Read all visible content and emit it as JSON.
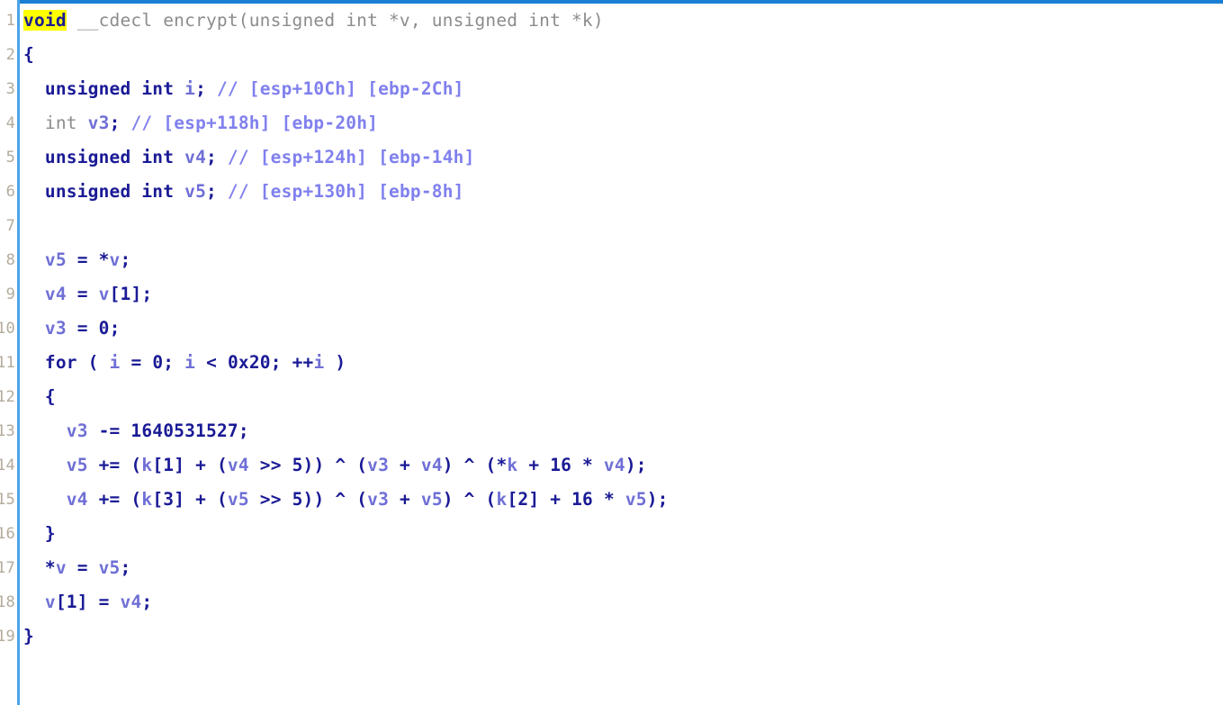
{
  "view": {
    "name": "hexrays-pseudocode",
    "accent_color": "#1a7fd4",
    "gutter_separator_color": "#4aa3e8",
    "background_color": "#ffffff",
    "highlight_color": "#ffff00",
    "keyword_color": "#1a1a96",
    "variable_color": "#6f6fd6",
    "comment_color": "#8080ee",
    "signature_color": "#8c8c8c",
    "lineno_color": "#b4ab9c"
  },
  "code": {
    "lines": [
      {
        "number": "1",
        "tokens": [
          {
            "t": "void",
            "c": "hl"
          },
          {
            "t": " __cdecl encrypt(unsigned int *v, unsigned int *k)",
            "c": "sig"
          }
        ]
      },
      {
        "number": "2",
        "tokens": [
          {
            "t": "{",
            "c": "kw"
          }
        ]
      },
      {
        "number": "3",
        "tokens": [
          {
            "t": "  ",
            "c": "kw"
          },
          {
            "t": "unsigned int",
            "c": "kw"
          },
          {
            "t": " ",
            "c": "kw"
          },
          {
            "t": "i",
            "c": "var"
          },
          {
            "t": "; ",
            "c": "kw"
          },
          {
            "t": "// [esp+10Ch] [ebp-2Ch]",
            "c": "comment"
          }
        ]
      },
      {
        "number": "4",
        "tokens": [
          {
            "t": "  ",
            "c": "kw"
          },
          {
            "t": "int",
            "c": "sig"
          },
          {
            "t": " ",
            "c": "kw"
          },
          {
            "t": "v3",
            "c": "var"
          },
          {
            "t": "; ",
            "c": "kw"
          },
          {
            "t": "// [esp+118h] [ebp-20h]",
            "c": "comment"
          }
        ]
      },
      {
        "number": "5",
        "tokens": [
          {
            "t": "  ",
            "c": "kw"
          },
          {
            "t": "unsigned int",
            "c": "kw"
          },
          {
            "t": " ",
            "c": "kw"
          },
          {
            "t": "v4",
            "c": "var"
          },
          {
            "t": "; ",
            "c": "kw"
          },
          {
            "t": "// [esp+124h] [ebp-14h]",
            "c": "comment"
          }
        ]
      },
      {
        "number": "6",
        "tokens": [
          {
            "t": "  ",
            "c": "kw"
          },
          {
            "t": "unsigned int",
            "c": "kw"
          },
          {
            "t": " ",
            "c": "kw"
          },
          {
            "t": "v5",
            "c": "var"
          },
          {
            "t": "; ",
            "c": "kw"
          },
          {
            "t": "// [esp+130h] [ebp-8h]",
            "c": "comment"
          }
        ]
      },
      {
        "number": "7",
        "tokens": [
          {
            "t": "",
            "c": "kw"
          }
        ]
      },
      {
        "number": "8",
        "tokens": [
          {
            "t": "  ",
            "c": "kw"
          },
          {
            "t": "v5",
            "c": "var"
          },
          {
            "t": " = *",
            "c": "kw"
          },
          {
            "t": "v",
            "c": "var"
          },
          {
            "t": ";",
            "c": "kw"
          }
        ]
      },
      {
        "number": "9",
        "tokens": [
          {
            "t": "  ",
            "c": "kw"
          },
          {
            "t": "v4",
            "c": "var"
          },
          {
            "t": " = ",
            "c": "kw"
          },
          {
            "t": "v",
            "c": "var"
          },
          {
            "t": "[",
            "c": "kw"
          },
          {
            "t": "1",
            "c": "num"
          },
          {
            "t": "];",
            "c": "kw"
          }
        ]
      },
      {
        "number": "10",
        "tokens": [
          {
            "t": "  ",
            "c": "kw"
          },
          {
            "t": "v3",
            "c": "var"
          },
          {
            "t": " = ",
            "c": "kw"
          },
          {
            "t": "0",
            "c": "num"
          },
          {
            "t": ";",
            "c": "kw"
          }
        ]
      },
      {
        "number": "11",
        "tokens": [
          {
            "t": "  ",
            "c": "kw"
          },
          {
            "t": "for",
            "c": "kw"
          },
          {
            "t": " ( ",
            "c": "kw"
          },
          {
            "t": "i",
            "c": "var"
          },
          {
            "t": " = ",
            "c": "kw"
          },
          {
            "t": "0",
            "c": "num"
          },
          {
            "t": "; ",
            "c": "kw"
          },
          {
            "t": "i",
            "c": "var"
          },
          {
            "t": " < ",
            "c": "kw"
          },
          {
            "t": "0x20",
            "c": "num"
          },
          {
            "t": "; ++",
            "c": "kw"
          },
          {
            "t": "i",
            "c": "var"
          },
          {
            "t": " )",
            "c": "kw"
          }
        ]
      },
      {
        "number": "12",
        "tokens": [
          {
            "t": "  {",
            "c": "kw"
          }
        ]
      },
      {
        "number": "13",
        "tokens": [
          {
            "t": "    ",
            "c": "kw"
          },
          {
            "t": "v3",
            "c": "var"
          },
          {
            "t": " -= ",
            "c": "kw"
          },
          {
            "t": "1640531527",
            "c": "num"
          },
          {
            "t": ";",
            "c": "kw"
          }
        ]
      },
      {
        "number": "14",
        "tokens": [
          {
            "t": "    ",
            "c": "kw"
          },
          {
            "t": "v5",
            "c": "var"
          },
          {
            "t": " += (",
            "c": "kw"
          },
          {
            "t": "k",
            "c": "var"
          },
          {
            "t": "[",
            "c": "kw"
          },
          {
            "t": "1",
            "c": "num"
          },
          {
            "t": "] + (",
            "c": "kw"
          },
          {
            "t": "v4",
            "c": "var"
          },
          {
            "t": " >> ",
            "c": "kw"
          },
          {
            "t": "5",
            "c": "num"
          },
          {
            "t": ")) ^ (",
            "c": "kw"
          },
          {
            "t": "v3",
            "c": "var"
          },
          {
            "t": " + ",
            "c": "kw"
          },
          {
            "t": "v4",
            "c": "var"
          },
          {
            "t": ") ^ (*",
            "c": "kw"
          },
          {
            "t": "k",
            "c": "var"
          },
          {
            "t": " + ",
            "c": "kw"
          },
          {
            "t": "16",
            "c": "num"
          },
          {
            "t": " * ",
            "c": "kw"
          },
          {
            "t": "v4",
            "c": "var"
          },
          {
            "t": ");",
            "c": "kw"
          }
        ]
      },
      {
        "number": "15",
        "tokens": [
          {
            "t": "    ",
            "c": "kw"
          },
          {
            "t": "v4",
            "c": "var"
          },
          {
            "t": " += (",
            "c": "kw"
          },
          {
            "t": "k",
            "c": "var"
          },
          {
            "t": "[",
            "c": "kw"
          },
          {
            "t": "3",
            "c": "num"
          },
          {
            "t": "] + (",
            "c": "kw"
          },
          {
            "t": "v5",
            "c": "var"
          },
          {
            "t": " >> ",
            "c": "kw"
          },
          {
            "t": "5",
            "c": "num"
          },
          {
            "t": ")) ^ (",
            "c": "kw"
          },
          {
            "t": "v3",
            "c": "var"
          },
          {
            "t": " + ",
            "c": "kw"
          },
          {
            "t": "v5",
            "c": "var"
          },
          {
            "t": ") ^ (",
            "c": "kw"
          },
          {
            "t": "k",
            "c": "var"
          },
          {
            "t": "[",
            "c": "kw"
          },
          {
            "t": "2",
            "c": "num"
          },
          {
            "t": "] + ",
            "c": "kw"
          },
          {
            "t": "16",
            "c": "num"
          },
          {
            "t": " * ",
            "c": "kw"
          },
          {
            "t": "v5",
            "c": "var"
          },
          {
            "t": ");",
            "c": "kw"
          }
        ]
      },
      {
        "number": "16",
        "tokens": [
          {
            "t": "  }",
            "c": "kw"
          }
        ]
      },
      {
        "number": "17",
        "tokens": [
          {
            "t": "  *",
            "c": "kw"
          },
          {
            "t": "v",
            "c": "var"
          },
          {
            "t": " = ",
            "c": "kw"
          },
          {
            "t": "v5",
            "c": "var"
          },
          {
            "t": ";",
            "c": "kw"
          }
        ]
      },
      {
        "number": "18",
        "tokens": [
          {
            "t": "  ",
            "c": "kw"
          },
          {
            "t": "v",
            "c": "var"
          },
          {
            "t": "[",
            "c": "kw"
          },
          {
            "t": "1",
            "c": "num"
          },
          {
            "t": "] = ",
            "c": "kw"
          },
          {
            "t": "v4",
            "c": "var"
          },
          {
            "t": ";",
            "c": "kw"
          }
        ]
      },
      {
        "number": "19",
        "tokens": [
          {
            "t": "}",
            "c": "kw"
          }
        ]
      }
    ]
  }
}
